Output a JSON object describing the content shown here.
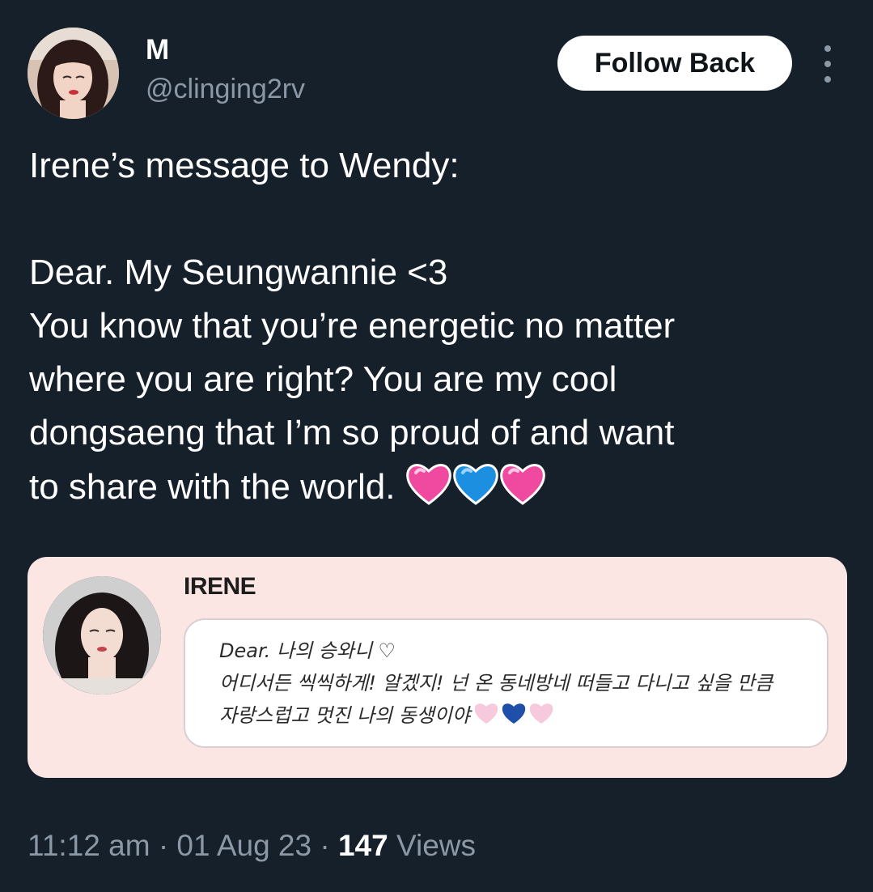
{
  "user": {
    "display_name": "M",
    "handle": "@clinging2rv",
    "follow_label": "Follow Back"
  },
  "tweet": {
    "lines": [
      "Irene’s message to Wendy:",
      "",
      "Dear. My Seungwannie <3",
      "You know that you’re energetic no matter",
      "where you are right? You are my cool",
      "dongsaeng that I’m so proud of and want",
      "to share with the world."
    ],
    "emoji": [
      "pink-heart",
      "blue-heart",
      "pink-heart"
    ]
  },
  "media": {
    "name": "IRENE",
    "note_lines": [
      "Dear. 나의 승와니 ♡",
      "어디서든 씩씩하게! 알겠지! 넌 온 동네방네 떠들고 다니고 싶을 만큼",
      "자랑스럽고 멋진 나의 동생이야"
    ]
  },
  "footer": {
    "time": "11:12 am",
    "separator": "·",
    "date": "01 Aug 23",
    "views_count": "147",
    "views_label": "Views"
  },
  "colors": {
    "background": "#15202b",
    "secondary_text": "#8b98a5",
    "card_background": "#fbe6e3",
    "pink_heart": "#f26bb2",
    "blue_heart": "#1d8fe0"
  }
}
